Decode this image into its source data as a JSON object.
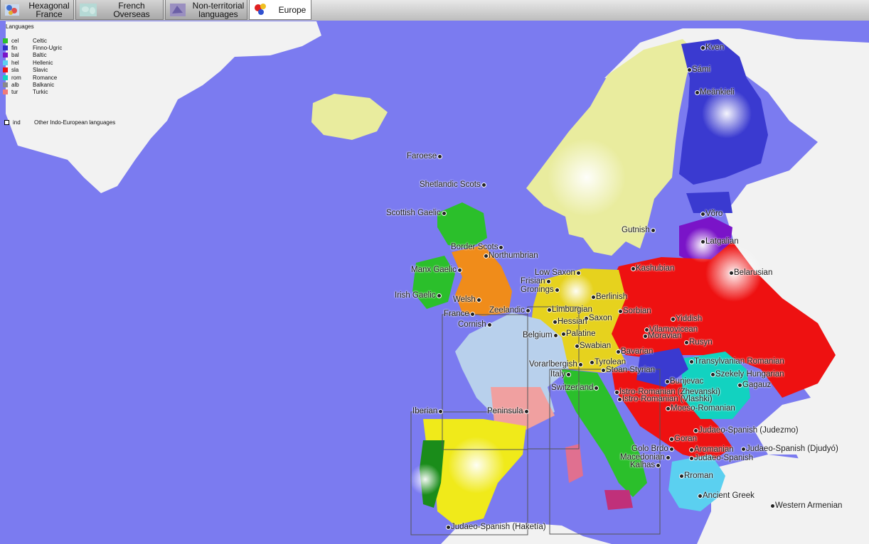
{
  "tabs": [
    {
      "label": "Hexagonal France",
      "lines": [
        "Hexagonal",
        "France"
      ]
    },
    {
      "label": "French Overseas",
      "lines": [
        "French",
        "Overseas"
      ]
    },
    {
      "label": "Non-territorial languages",
      "lines": [
        "Non-territorial",
        "languages"
      ]
    },
    {
      "label": "Europe",
      "lines": [
        "Europe"
      ],
      "active": true
    }
  ],
  "legend": {
    "title": "Languages",
    "items": [
      {
        "code": "cel",
        "name": "Celtic",
        "color": "#2bbf2b"
      },
      {
        "code": "fin",
        "name": "Finno-Ugric",
        "color": "#3030c8"
      },
      {
        "code": "bal",
        "name": "Baltic",
        "color": "#7a14c8"
      },
      {
        "code": "hel",
        "name": "Hellenic",
        "color": "#5bd0f0"
      },
      {
        "code": "sla",
        "name": "Slavic",
        "color": "#ee1111"
      },
      {
        "code": "rom",
        "name": "Romance",
        "color": "#12d2c0"
      },
      {
        "code": "alb",
        "name": "Balkanic",
        "color": "#8a8a8a"
      },
      {
        "code": "tur",
        "name": "Turkic",
        "color": "#f07a7a"
      }
    ],
    "other": {
      "code": "ind",
      "name": "Other Indo-European languages"
    }
  },
  "labels": [
    "Kven",
    "Sámi",
    "Meänkieli",
    "Faroese",
    "Shetlandic Scots",
    "Scottish Gaelic",
    "Võro",
    "Latgalian",
    "Gutnish",
    "Border Scots",
    "Northumbrian",
    "Manx Gaelic",
    "Kashubian",
    "Belarusian",
    "Low Saxon",
    "Frisian",
    "Gronings",
    "Irish Gaelic",
    "Welsh",
    "Berlinish",
    "France",
    "Zeelandic",
    "Limburgian",
    "Sorbian",
    "Saxon",
    "Cornish",
    "Hessian",
    "Yiddish",
    "Belgium",
    "Palatine",
    "Vilamovicean",
    "Moravian",
    "Rusyn",
    "Swabian",
    "Bavarian",
    "Vorarlbergish",
    "Tyrolean",
    "Transylvanian Romanian",
    "Italy",
    "Stoan Styrian",
    "Szekely Hungarian",
    "Bunjevac",
    "Switzerland",
    "Gagauz",
    "Istro-Romanian (Zhevanski)",
    "Istro-Romanian (Vlashki)",
    "Moeso-Romanian",
    "Iberian",
    "Peninsula",
    "Judaeo-Spanish (Judezmo)",
    "Goran",
    "Golo Brdo",
    "Aromanian",
    "Judaeo-Spanish (Djudyó)",
    "Macedonian",
    "Judaeo-Spanish",
    "Kalhas",
    "Rroman",
    "Ancient Greek",
    "Western Armenian",
    "Judaeo-Spanish (Haketía)"
  ],
  "region_codes": [
    "fin",
    "sca",
    "bal",
    "pla",
    "ire",
    "arl",
    "cel",
    "cas",
    "por",
    "hel",
    "rom",
    "pol",
    "mde"
  ]
}
